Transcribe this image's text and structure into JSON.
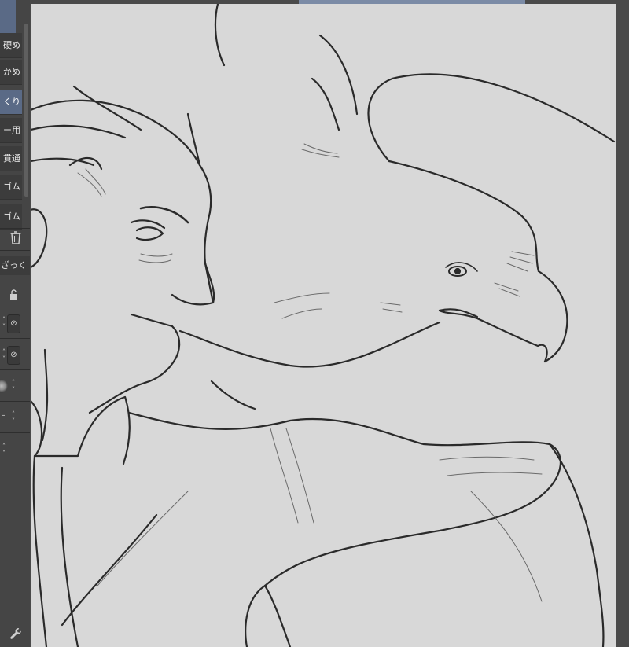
{
  "brush_subtools": [
    {
      "label": "硬め",
      "active": false
    },
    {
      "label": "かめ",
      "active": false
    },
    {
      "label": "くり",
      "active": true
    },
    {
      "label": "ー用",
      "active": false
    },
    {
      "label": "貫通",
      "active": false
    },
    {
      "label": "ゴム",
      "active": false
    },
    {
      "label": "ゴム",
      "active": false
    }
  ],
  "tool_setting": {
    "label": "ざっく"
  },
  "icons": {
    "delete": "trash-icon",
    "lock": "lock-icon",
    "settings": "wrench-icon",
    "brush_preview": "brush-tip-icon"
  },
  "colors": {
    "panel": "#454545",
    "active_item": "#5a6a86",
    "canvas": "#d8d8d8",
    "line": "#2a2a2a"
  }
}
